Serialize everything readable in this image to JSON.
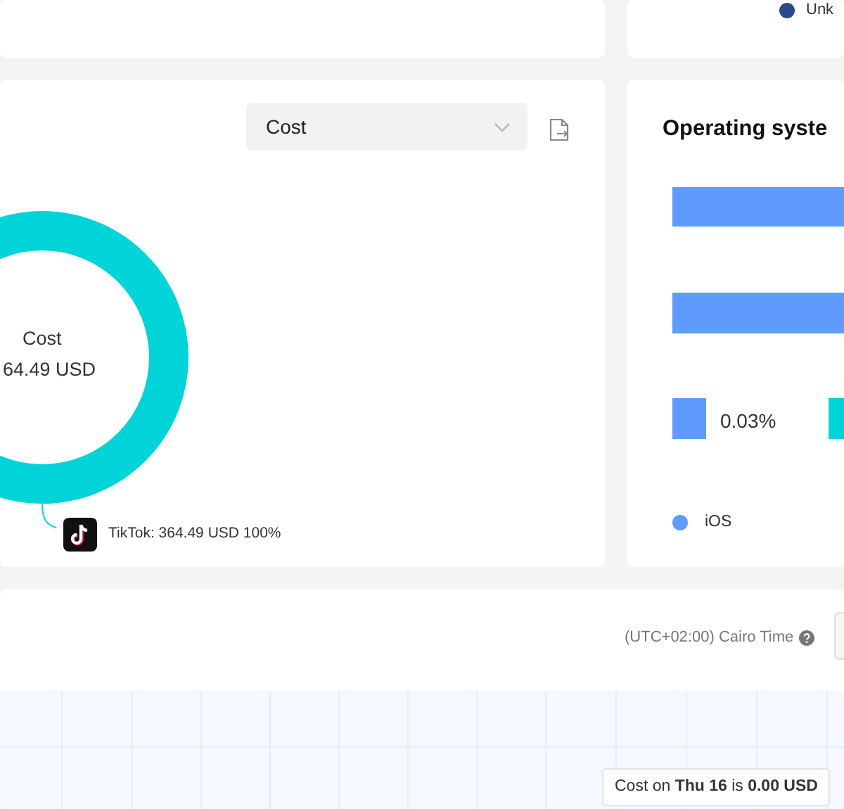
{
  "top_legend": {
    "label": "Unk",
    "color": "#2b4a8b"
  },
  "cost_panel": {
    "metric_select": {
      "value": "Cost"
    },
    "center_label": "Cost",
    "center_value": "64.49 USD",
    "legend": [
      {
        "label": "TikTok: 364.49 USD 100%"
      }
    ]
  },
  "os_panel": {
    "title": "Operating syste",
    "bar_label": "0.03%",
    "legend": [
      {
        "label": "iOS",
        "color": "#5f9afd"
      }
    ]
  },
  "trend_panel": {
    "timezone": "(UTC+02:00) Cairo Time",
    "tooltip": "Cost on **Thu 16** is **0.00 USD**"
  }
}
